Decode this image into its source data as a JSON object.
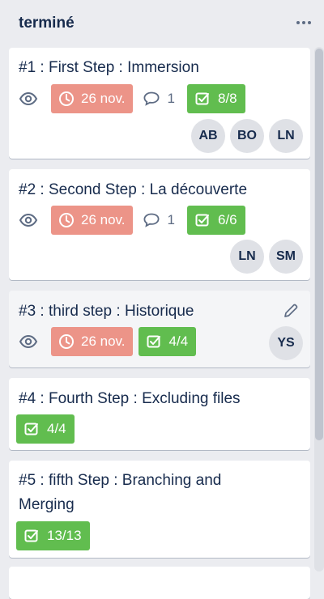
{
  "list": {
    "title": "terminé",
    "menu_icon": "more-horizontal-icon"
  },
  "cards": [
    {
      "title": "#1 : First Step : Immersion",
      "watch_icon": "eye-icon",
      "due": "26 nov.",
      "comments": "1",
      "checklist": "8/8",
      "members": [
        "AB",
        "BO",
        "LN"
      ]
    },
    {
      "title": "#2 : Second Step : La découverte",
      "watch_icon": "eye-icon",
      "due": "26 nov.",
      "comments": "1",
      "checklist": "6/6",
      "members": [
        "LN",
        "SM"
      ]
    },
    {
      "title": "#3 : third step : Historique",
      "watch_icon": "eye-icon",
      "due": "26 nov.",
      "checklist": "4/4",
      "members": [
        "YS"
      ],
      "edit_icon": "pencil-icon"
    },
    {
      "title": "#4 : Fourth Step : Excluding files",
      "checklist": "4/4"
    },
    {
      "title_line1": "#5 : fifth Step : Branching and",
      "title_line2": "Merging",
      "checklist": "13/13"
    }
  ],
  "colors": {
    "due_overdue": "#ec9488",
    "checklist_complete": "#61bd4f",
    "list_background": "#ebecf0"
  }
}
